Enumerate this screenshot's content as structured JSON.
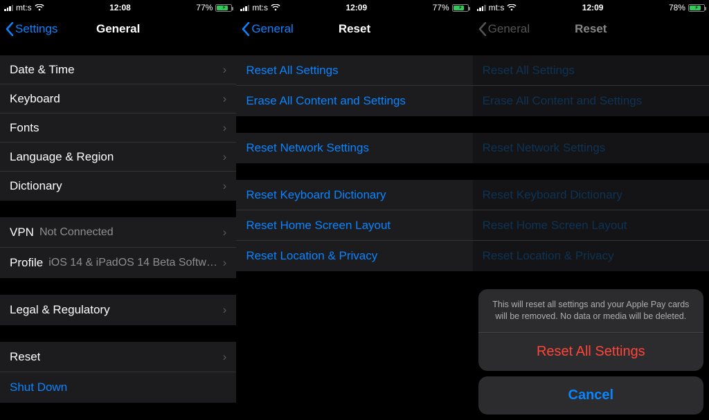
{
  "colors": {
    "accent": "#0a84ff",
    "destructive": "#ff453a",
    "battery_green": "#34c759"
  },
  "screen1": {
    "status": {
      "carrier": "mt:s",
      "time": "12:08",
      "battery_pct": "77%",
      "battery_fill_pct": 77
    },
    "nav": {
      "back": "Settings",
      "title": "General"
    },
    "groups": [
      {
        "rows": [
          {
            "label": "Date & Time",
            "chevron": true
          },
          {
            "label": "Keyboard",
            "chevron": true
          },
          {
            "label": "Fonts",
            "chevron": true
          },
          {
            "label": "Language & Region",
            "chevron": true
          },
          {
            "label": "Dictionary",
            "chevron": true
          }
        ]
      },
      {
        "rows": [
          {
            "label": "VPN",
            "value": "Not Connected",
            "chevron": true
          },
          {
            "label": "Profile",
            "value": "iOS 14 & iPadOS 14 Beta Softwar…",
            "chevron": true
          }
        ]
      },
      {
        "rows": [
          {
            "label": "Legal & Regulatory",
            "chevron": true
          }
        ]
      },
      {
        "rows": [
          {
            "label": "Reset",
            "chevron": true
          },
          {
            "label": "Shut Down",
            "link": true
          }
        ]
      }
    ]
  },
  "screen2": {
    "status": {
      "carrier": "mt:s",
      "time": "12:09",
      "battery_pct": "77%",
      "battery_fill_pct": 77
    },
    "nav": {
      "back": "General",
      "title": "Reset"
    },
    "groups": [
      {
        "rows": [
          {
            "label": "Reset All Settings"
          },
          {
            "label": "Erase All Content and Settings"
          }
        ]
      },
      {
        "rows": [
          {
            "label": "Reset Network Settings"
          }
        ]
      },
      {
        "rows": [
          {
            "label": "Reset Keyboard Dictionary"
          },
          {
            "label": "Reset Home Screen Layout"
          },
          {
            "label": "Reset Location & Privacy"
          }
        ]
      }
    ]
  },
  "screen3": {
    "status": {
      "carrier": "mt:s",
      "time": "12:09",
      "battery_pct": "78%",
      "battery_fill_pct": 78
    },
    "nav": {
      "back": "General",
      "title": "Reset"
    },
    "groups": [
      {
        "rows": [
          {
            "label": "Reset All Settings"
          },
          {
            "label": "Erase All Content and Settings"
          }
        ]
      },
      {
        "rows": [
          {
            "label": "Reset Network Settings"
          }
        ]
      },
      {
        "rows": [
          {
            "label": "Reset Keyboard Dictionary"
          },
          {
            "label": "Reset Home Screen Layout"
          },
          {
            "label": "Reset Location & Privacy"
          }
        ]
      }
    ],
    "sheet": {
      "message": "This will reset all settings and your Apple Pay cards will be removed. No data or media will be deleted.",
      "action": "Reset All Settings",
      "cancel": "Cancel"
    }
  }
}
